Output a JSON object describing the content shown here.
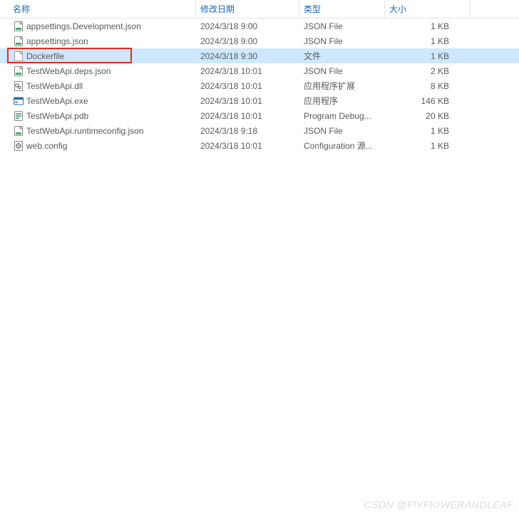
{
  "columns": {
    "name": "名称",
    "date": "修改日期",
    "type": "类型",
    "size": "大小"
  },
  "files": [
    {
      "name": "appsettings.Development.json",
      "date": "2024/3/18 9:00",
      "type": "JSON File",
      "size": "1 KB",
      "icon": "json",
      "selected": false,
      "highlighted": false
    },
    {
      "name": "appsettings.json",
      "date": "2024/3/18 9:00",
      "type": "JSON File",
      "size": "1 KB",
      "icon": "json",
      "selected": false,
      "highlighted": false
    },
    {
      "name": "Dockerfile",
      "date": "2024/3/18 9:30",
      "type": "文件",
      "size": "1 KB",
      "icon": "blank",
      "selected": true,
      "highlighted": true
    },
    {
      "name": "TestWebApi.deps.json",
      "date": "2024/3/18 10:01",
      "type": "JSON File",
      "size": "2 KB",
      "icon": "json",
      "selected": false,
      "highlighted": false
    },
    {
      "name": "TestWebApi.dll",
      "date": "2024/3/18 10:01",
      "type": "应用程序扩展",
      "size": "8 KB",
      "icon": "dll",
      "selected": false,
      "highlighted": false
    },
    {
      "name": "TestWebApi.exe",
      "date": "2024/3/18 10:01",
      "type": "应用程序",
      "size": "146 KB",
      "icon": "exe",
      "selected": false,
      "highlighted": false
    },
    {
      "name": "TestWebApi.pdb",
      "date": "2024/3/18 10:01",
      "type": "Program Debug...",
      "size": "20 KB",
      "icon": "pdb",
      "selected": false,
      "highlighted": false
    },
    {
      "name": "TestWebApi.runtimeconfig.json",
      "date": "2024/3/18 9:18",
      "type": "JSON File",
      "size": "1 KB",
      "icon": "json",
      "selected": false,
      "highlighted": false
    },
    {
      "name": "web.config",
      "date": "2024/3/18 10:01",
      "type": "Configuration 源...",
      "size": "1 KB",
      "icon": "config",
      "selected": false,
      "highlighted": false
    }
  ],
  "watermark": "CSDN @FlYFlOWERANDLEAF"
}
